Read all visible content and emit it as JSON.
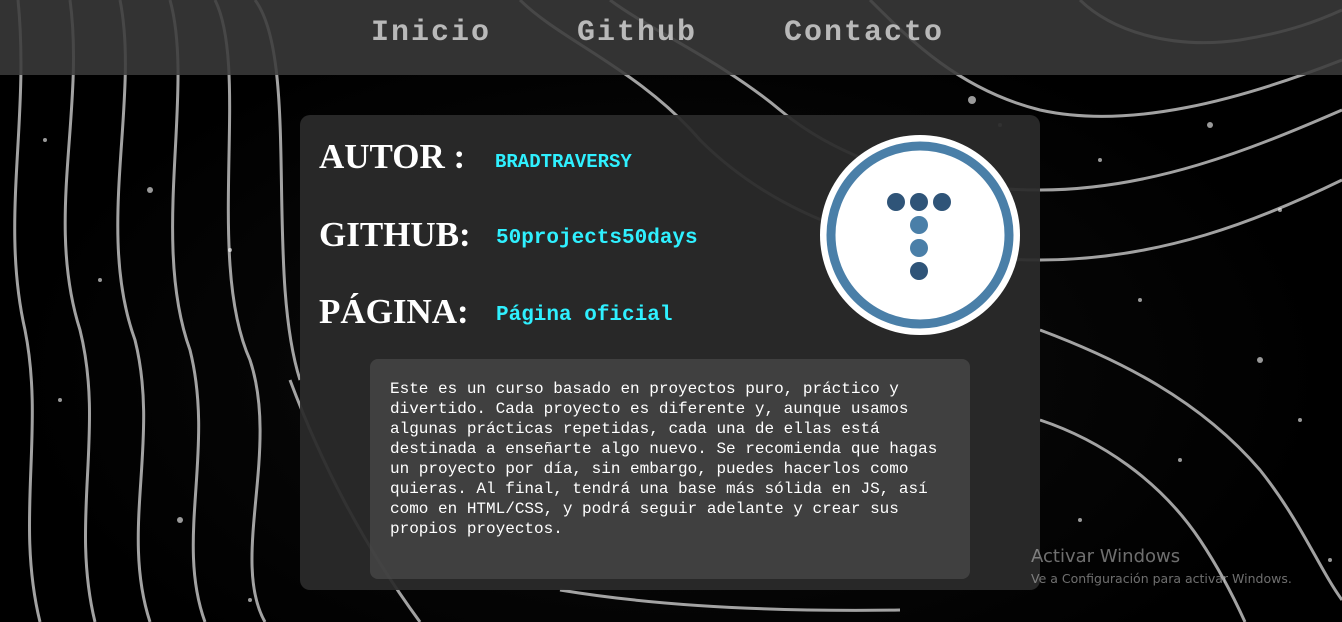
{
  "nav": {
    "items": [
      {
        "label": "Inicio"
      },
      {
        "label": "Github"
      },
      {
        "label": "Contacto"
      }
    ]
  },
  "card": {
    "author": {
      "label": "AUTOR :",
      "value": "BRADTRAVERSY"
    },
    "github": {
      "label": "GITHUB:",
      "value": "50projects50days"
    },
    "page": {
      "label": "PÁGINA:",
      "value": "Página oficial"
    },
    "logo_icon": "traversy-media-logo",
    "description": "Este es un curso basado en proyectos puro, práctico y divertido. Cada proyecto es diferente y, aunque usamos algunas prácticas repetidas, cada una de ellas está destinada a enseñarte algo nuevo. Se recomienda que hagas un proyecto por día, sin embargo, puedes hacerlos como quieras. Al final, tendrá una base más sólida en JS, así como en HTML/CSS, y podrá seguir adelante y crear sus propios proyectos."
  },
  "watermark": {
    "title": "Activar Windows",
    "subtitle": "Ve a Configuración para activar Windows."
  },
  "colors": {
    "link_cyan": "#2ff0ff",
    "nav_text": "#b9b9b9",
    "logo_ring": "#4a7fa8",
    "logo_dots": "#2f5478"
  }
}
